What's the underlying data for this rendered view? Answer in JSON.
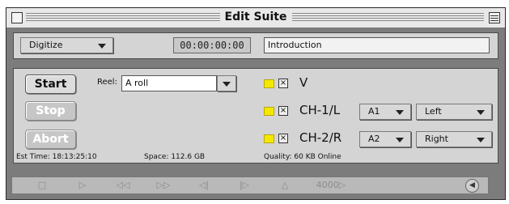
{
  "window": {
    "title": "Edit Suite"
  },
  "mode": {
    "selected": "Digitize"
  },
  "timecode": "00:00:00:00",
  "clip_name": "Introduction",
  "buttons": {
    "start": "Start",
    "stop": "Stop",
    "abort": "Abort"
  },
  "reel": {
    "label": "Reel:",
    "value": "A roll"
  },
  "tracks": [
    {
      "label": "V",
      "checked": "×"
    },
    {
      "label": "CH-1/L",
      "checked": "×",
      "channel": "A1",
      "side": "Left"
    },
    {
      "label": "CH-2/R",
      "checked": "×",
      "channel": "A2",
      "side": "Right"
    }
  ],
  "status": {
    "est_time": "Est Time: 18:13:25:10",
    "space": "Space: 112.6 GB",
    "quality": "Quality: 60 KB Online"
  },
  "transport": [
    "□",
    "▷",
    "◁◁",
    "▷▷",
    "◁|",
    "|▷",
    "△",
    "4000▷",
    "◀"
  ]
}
